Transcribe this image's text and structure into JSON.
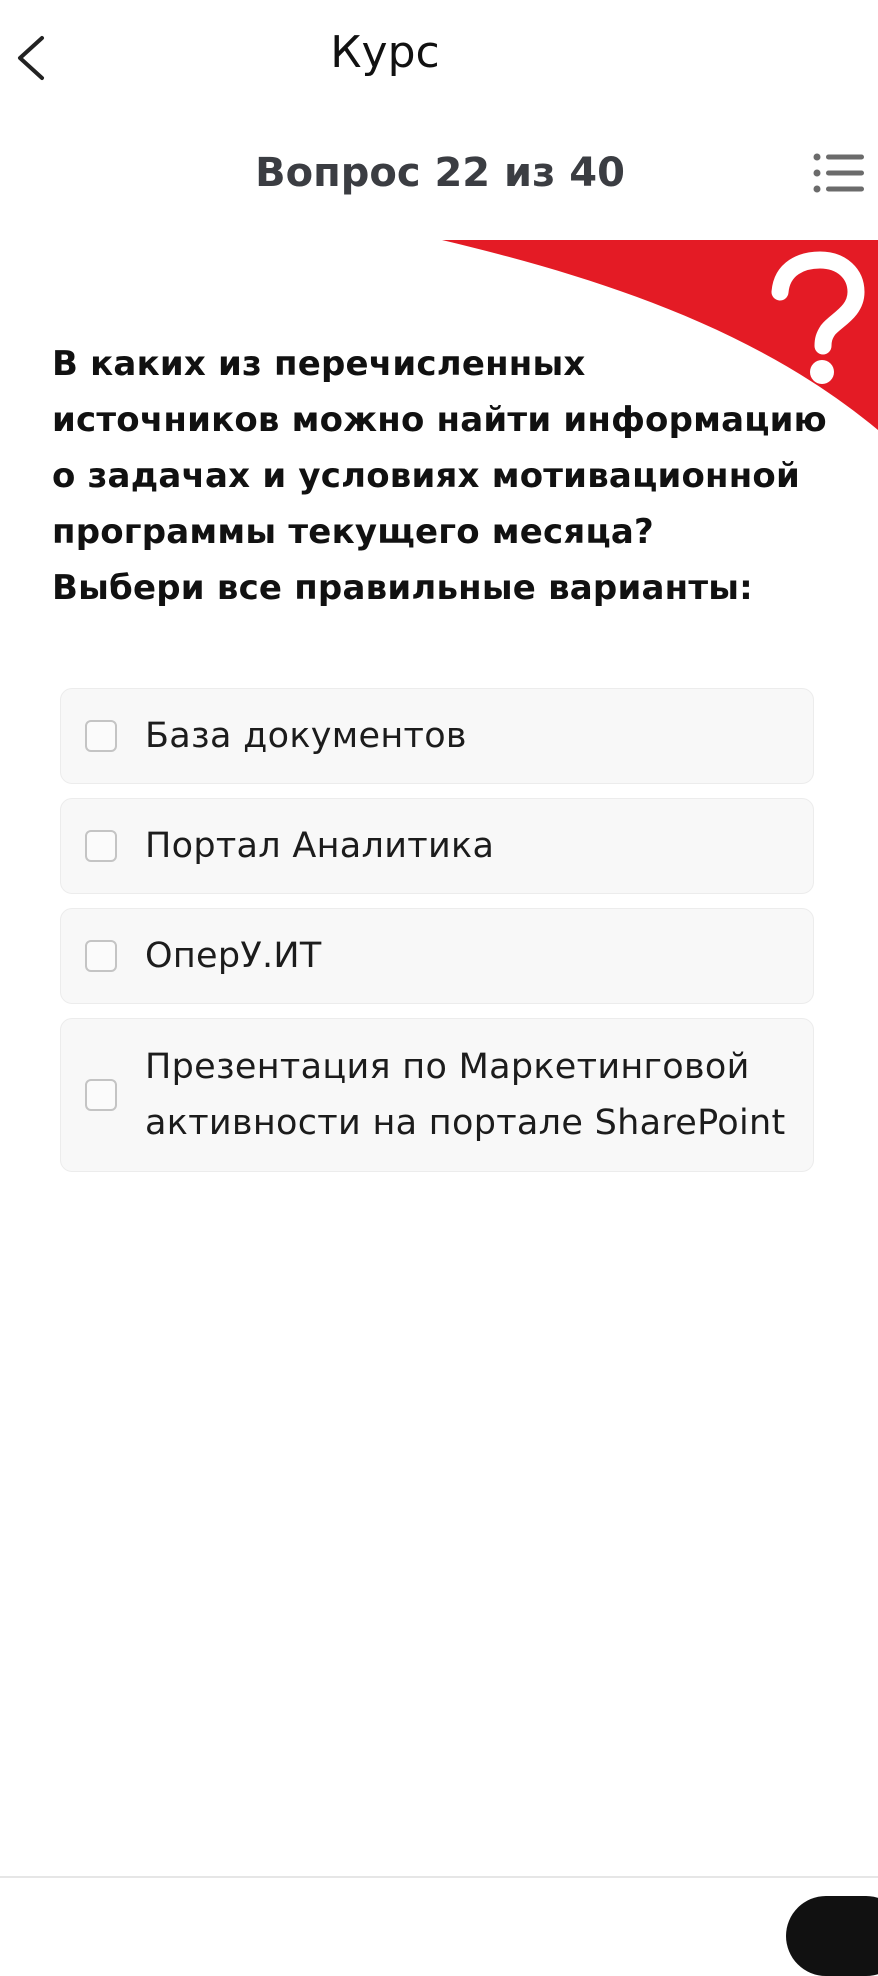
{
  "header": {
    "title": "Курс",
    "back_icon": "chevron-left-icon",
    "menu_icon": "list-icon"
  },
  "quiz": {
    "counter": "Вопрос 22 из 40",
    "question": "В каких из перечисленных\nисточников можно найти информацию\nо задачах и условиях мотивационной\nпрограммы текущего месяца?\nВыбери все правильные варианты:",
    "options": [
      {
        "label": "База документов",
        "checked": false
      },
      {
        "label": "Портал Аналитика",
        "checked": false
      },
      {
        "label": "ОперУ.ИТ",
        "checked": false
      },
      {
        "label": "Презентация по Маркетинговой активности на портале SharePoint",
        "checked": false
      }
    ]
  },
  "banner": {
    "icon": "question-mark-icon",
    "accent_color": "#e41b25"
  }
}
